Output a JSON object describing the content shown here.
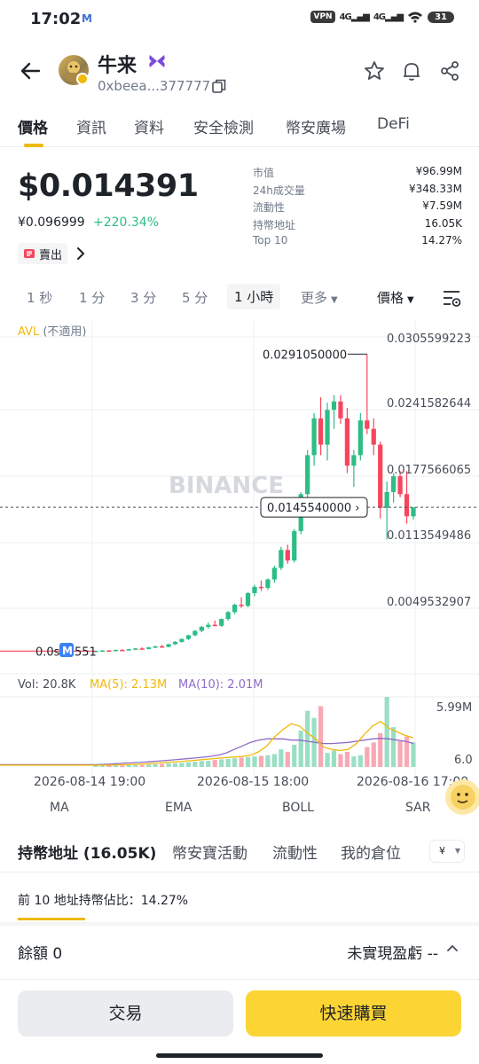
{
  "status_bar": {
    "time": "17:02",
    "notification_letter": "M",
    "vpn": "VPN",
    "network_1": "4G",
    "network_2": "4G",
    "battery": "31"
  },
  "header": {
    "token_name": "牛来",
    "address": "0xbeea...377777"
  },
  "tabs": [
    "價格",
    "資訊",
    "資料",
    "安全檢測",
    "幣安廣場",
    "DeFi"
  ],
  "price": {
    "usd": "$0.014391",
    "cny": "¥0.096999",
    "change": "+220.34%",
    "sell_label": "賣出"
  },
  "stats": [
    {
      "label": "市值",
      "value": "¥96.99M"
    },
    {
      "label": "24h成交量",
      "value": "¥348.33M"
    },
    {
      "label": "流動性",
      "value": "¥7.59M"
    },
    {
      "label": "持幣地址",
      "value": "16.05K"
    },
    {
      "label": "Top 10",
      "value": "14.27%"
    }
  ],
  "intervals": [
    "1 秒",
    "1 分",
    "3 分",
    "5 分",
    "1 小時",
    "更多"
  ],
  "price_type": "價格",
  "chart": {
    "avl_label": "AVL",
    "avl_status": "(不適用)",
    "watermark": "BINANCE",
    "marker_letter": "M",
    "y_ticks": [
      "0.0305599223",
      "0.0241582644",
      "0.0177566065",
      "0.0113549486",
      "0.0049532907"
    ],
    "high_label": "0.0291050000",
    "current_label": "0.0145540000",
    "low_label": "0.0s65551",
    "vol_label": "Vol: 20.8K",
    "ma5_label": "MA(5): 2.13M",
    "ma10_label": "MA(10): 2.01M",
    "vol_ticks": [
      "5.99M",
      "6.0"
    ],
    "x_labels": [
      "2026-08-14 19:00",
      "2026-08-15 18:00",
      "2026-08-16 17:00"
    ]
  },
  "chart_data": {
    "type": "candlestick",
    "title": "",
    "y_range": [
      0.0,
      0.0305599223
    ],
    "x_range": [
      "2026-08-14 19:00",
      "2026-08-16 17:00"
    ],
    "candles": [
      {
        "o": 0.0009,
        "h": 0.00095,
        "l": 0.00085,
        "c": 0.00092
      },
      {
        "o": 0.00092,
        "h": 0.001,
        "l": 0.00088,
        "c": 0.00096
      },
      {
        "o": 0.00096,
        "h": 0.00102,
        "l": 0.0009,
        "c": 0.00094
      },
      {
        "o": 0.00094,
        "h": 0.00105,
        "l": 0.00092,
        "c": 0.00101
      },
      {
        "o": 0.00101,
        "h": 0.0011,
        "l": 0.00097,
        "c": 0.00098
      },
      {
        "o": 0.00098,
        "h": 0.00112,
        "l": 0.00095,
        "c": 0.00108
      },
      {
        "o": 0.00108,
        "h": 0.0012,
        "l": 0.00102,
        "c": 0.00115
      },
      {
        "o": 0.00115,
        "h": 0.00125,
        "l": 0.00108,
        "c": 0.0011
      },
      {
        "o": 0.0011,
        "h": 0.0013,
        "l": 0.00105,
        "c": 0.00125
      },
      {
        "o": 0.00125,
        "h": 0.0014,
        "l": 0.00118,
        "c": 0.00135
      },
      {
        "o": 0.00135,
        "h": 0.0015,
        "l": 0.00128,
        "c": 0.0013
      },
      {
        "o": 0.0013,
        "h": 0.0016,
        "l": 0.00125,
        "c": 0.00155
      },
      {
        "o": 0.00155,
        "h": 0.00185,
        "l": 0.00148,
        "c": 0.00178
      },
      {
        "o": 0.00178,
        "h": 0.0021,
        "l": 0.0017,
        "c": 0.00205
      },
      {
        "o": 0.00205,
        "h": 0.00245,
        "l": 0.00195,
        "c": 0.0024
      },
      {
        "o": 0.0024,
        "h": 0.0029,
        "l": 0.00232,
        "c": 0.00282
      },
      {
        "o": 0.00282,
        "h": 0.0033,
        "l": 0.0027,
        "c": 0.0032
      },
      {
        "o": 0.0032,
        "h": 0.0036,
        "l": 0.003,
        "c": 0.0034
      },
      {
        "o": 0.0034,
        "h": 0.0038,
        "l": 0.00325,
        "c": 0.0033
      },
      {
        "o": 0.0033,
        "h": 0.004,
        "l": 0.0032,
        "c": 0.00395
      },
      {
        "o": 0.00395,
        "h": 0.0047,
        "l": 0.0038,
        "c": 0.0046
      },
      {
        "o": 0.0046,
        "h": 0.0054,
        "l": 0.0044,
        "c": 0.0053
      },
      {
        "o": 0.0053,
        "h": 0.006,
        "l": 0.005,
        "c": 0.0052
      },
      {
        "o": 0.0052,
        "h": 0.0065,
        "l": 0.00505,
        "c": 0.0064
      },
      {
        "o": 0.0064,
        "h": 0.0072,
        "l": 0.0061,
        "c": 0.007
      },
      {
        "o": 0.007,
        "h": 0.0076,
        "l": 0.0066,
        "c": 0.0069
      },
      {
        "o": 0.0069,
        "h": 0.0078,
        "l": 0.0067,
        "c": 0.0077
      },
      {
        "o": 0.0077,
        "h": 0.009,
        "l": 0.0074,
        "c": 0.0088
      },
      {
        "o": 0.0088,
        "h": 0.0108,
        "l": 0.0086,
        "c": 0.0105
      },
      {
        "o": 0.0105,
        "h": 0.011,
        "l": 0.0092,
        "c": 0.0095
      },
      {
        "o": 0.0095,
        "h": 0.0125,
        "l": 0.0093,
        "c": 0.0123
      },
      {
        "o": 0.0123,
        "h": 0.016,
        "l": 0.012,
        "c": 0.0158
      },
      {
        "o": 0.0158,
        "h": 0.02,
        "l": 0.0154,
        "c": 0.0195
      },
      {
        "o": 0.0195,
        "h": 0.0235,
        "l": 0.0185,
        "c": 0.023
      },
      {
        "o": 0.023,
        "h": 0.025,
        "l": 0.0195,
        "c": 0.0205
      },
      {
        "o": 0.0205,
        "h": 0.0245,
        "l": 0.019,
        "c": 0.0238
      },
      {
        "o": 0.0238,
        "h": 0.0252,
        "l": 0.022,
        "c": 0.0246
      },
      {
        "o": 0.0246,
        "h": 0.0252,
        "l": 0.0225,
        "c": 0.023
      },
      {
        "o": 0.023,
        "h": 0.024,
        "l": 0.0178,
        "c": 0.0185
      },
      {
        "o": 0.0185,
        "h": 0.02,
        "l": 0.0165,
        "c": 0.0195
      },
      {
        "o": 0.0195,
        "h": 0.0235,
        "l": 0.019,
        "c": 0.0228
      },
      {
        "o": 0.0228,
        "h": 0.0291,
        "l": 0.0215,
        "c": 0.022
      },
      {
        "o": 0.022,
        "h": 0.023,
        "l": 0.0195,
        "c": 0.0205
      },
      {
        "o": 0.0205,
        "h": 0.0208,
        "l": 0.0135,
        "c": 0.0145
      },
      {
        "o": 0.0145,
        "h": 0.017,
        "l": 0.0115,
        "c": 0.016
      },
      {
        "o": 0.016,
        "h": 0.0178,
        "l": 0.015,
        "c": 0.0175
      },
      {
        "o": 0.0175,
        "h": 0.018,
        "l": 0.0155,
        "c": 0.0158
      },
      {
        "o": 0.0158,
        "h": 0.018,
        "l": 0.013,
        "c": 0.0137
      },
      {
        "o": 0.0137,
        "h": 0.0145,
        "l": 0.0134,
        "c": 0.01455
      }
    ],
    "volume_range": [
      0,
      5990000
    ],
    "volumes": [
      120000,
      110000,
      150000,
      140000,
      130000,
      160000,
      180000,
      170000,
      210000,
      230000,
      260000,
      300000,
      320000,
      350000,
      400000,
      450000,
      500000,
      520000,
      600000,
      650000,
      700000,
      750000,
      800000,
      850000,
      900000,
      950000,
      1000000,
      1100000,
      1500000,
      1300000,
      1900000,
      3100000,
      4800000,
      4200000,
      5200000,
      1200000,
      1400000,
      1100000,
      1300000,
      900000,
      1000000,
      1700000,
      2100000,
      2900000,
      5990000,
      3400000,
      2200000,
      2600000,
      2100000
    ],
    "ma5": [
      150000,
      160000,
      170000,
      180000,
      200000,
      230000,
      260000,
      300000,
      350000,
      400000,
      450000,
      500000,
      560000,
      620000,
      680000,
      740000,
      800000,
      850000,
      900000,
      1000000,
      1300000,
      1800000,
      2600000,
      3200000,
      3700000,
      3500000,
      2900000,
      2400000,
      1700000,
      1500000,
      1400000,
      1500000,
      2000000,
      2800000,
      3500000,
      3900000,
      3300000,
      3000000,
      2700000,
      2500000
    ],
    "ma10": [
      200000,
      230000,
      260000,
      300000,
      340000,
      380000,
      420000,
      470000,
      520000,
      580000,
      640000,
      700000,
      760000,
      830000,
      900000,
      1000000,
      1200000,
      1500000,
      1800000,
      2100000,
      2300000,
      2400000,
      2400000,
      2400000,
      2300000,
      2300000,
      2200000,
      2100000,
      2000000,
      2000000,
      2050000,
      2100000,
      2200000,
      2300000,
      2400000,
      2450000,
      2400000,
      2300000,
      2200000,
      2010000
    ]
  },
  "indicators": [
    "MA",
    "EMA",
    "BOLL",
    "SAR"
  ],
  "holder_tabs": [
    "持幣地址 (16.05K)",
    "幣安寶活動",
    "流動性",
    "我的倉位"
  ],
  "currency_toggle": "¥",
  "top10_text": "前 10 地址持幣佔比：14.27%",
  "balance": {
    "label": "餘額 0",
    "pnl_label": "未實現盈虧 --"
  },
  "buttons": {
    "trade": "交易",
    "quick_buy": "快速購買"
  },
  "colors": {
    "up": "#2ebd85",
    "down": "#f6465d",
    "accent": "#f0b90b",
    "ma5": "#f0b90b",
    "ma10": "#8e6bc8"
  }
}
